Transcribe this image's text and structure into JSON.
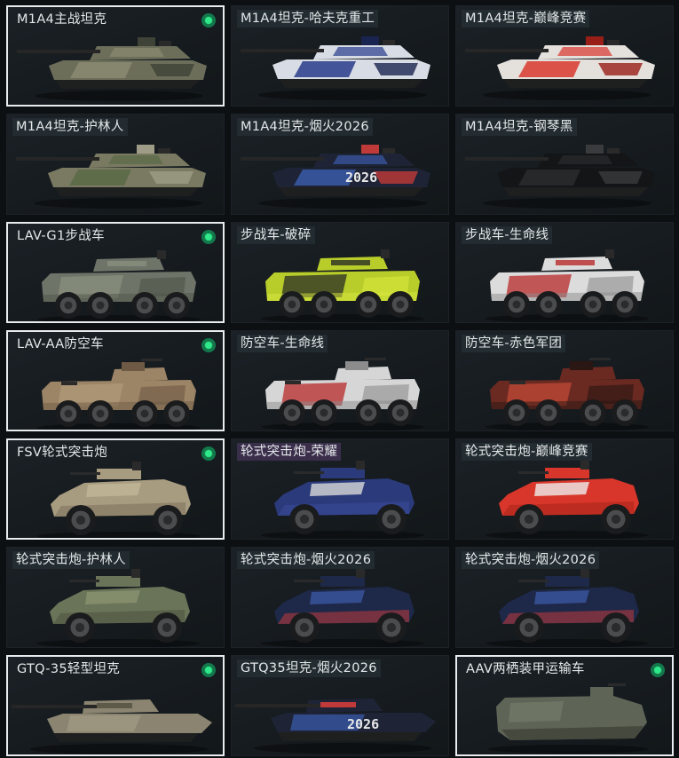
{
  "cards": [
    {
      "label": "M1A4主战坦克",
      "type": "tank",
      "owned": true,
      "selected": true,
      "base": "#6c6e5a",
      "accent": "#8b8a72",
      "accent2": "#3f4236"
    },
    {
      "label": "M1A4坦克-哈夫克重工",
      "type": "tank",
      "owned": false,
      "selected": false,
      "base": "#d8dce4",
      "accent": "#2a3c8c",
      "accent2": "#1a2450"
    },
    {
      "label": "M1A4坦克-巅峰竞赛",
      "type": "tank",
      "owned": false,
      "selected": false,
      "base": "#e4e0dc",
      "accent": "#d8382e",
      "accent2": "#9a1e18"
    },
    {
      "label": "M1A4坦克-护林人",
      "type": "tank",
      "owned": false,
      "selected": false,
      "base": "#7a7a62",
      "accent": "#5a6a46",
      "accent2": "#9e9c86"
    },
    {
      "label": "M1A4坦克-烟火2026",
      "type": "tank",
      "owned": false,
      "selected": false,
      "base": "#1e2436",
      "accent": "#3a5aa8",
      "accent2": "#c03a3a",
      "text": "2026"
    },
    {
      "label": "M1A4坦克-钢琴黑",
      "type": "tank",
      "owned": false,
      "selected": false,
      "base": "#141516",
      "accent": "#2a2b2d",
      "accent2": "#3a3b3d"
    },
    {
      "label": "LAV-G1步战车",
      "type": "ifv",
      "owned": true,
      "selected": true,
      "base": "#6e7468",
      "accent": "#8a907e",
      "accent2": "#4e5448"
    },
    {
      "label": "步战车-破碎",
      "type": "ifv",
      "owned": false,
      "selected": false,
      "base": "#b8cc2a",
      "accent": "#2a2e26",
      "accent2": "#d8e840"
    },
    {
      "label": "步战车-生命线",
      "type": "ifv",
      "owned": false,
      "selected": false,
      "base": "#dcdcdc",
      "accent": "#b82a2a",
      "accent2": "#8c8c8c"
    },
    {
      "label": "LAV-AA防空车",
      "type": "aa",
      "owned": true,
      "selected": true,
      "base": "#9c8466",
      "accent": "#b09a7a",
      "accent2": "#6e5a44"
    },
    {
      "label": "防空车-生命线",
      "type": "aa",
      "owned": false,
      "selected": false,
      "base": "#d6d6d6",
      "accent": "#b82a2a",
      "accent2": "#8c8c8c"
    },
    {
      "label": "防空车-赤色军团",
      "type": "aa",
      "owned": false,
      "selected": false,
      "base": "#6a2a22",
      "accent": "#c24a36",
      "accent2": "#2a1612"
    },
    {
      "label": "FSV轮式突击炮",
      "type": "fsv",
      "owned": true,
      "selected": true,
      "base": "#a89c80",
      "accent": "#c2b698",
      "accent2": "#7a705a"
    },
    {
      "label": "轮式突击炮-荣耀",
      "type": "fsv",
      "owned": false,
      "selected": false,
      "base": "#2a3a7a",
      "accent": "#d8d8d8",
      "accent2": "#3a4a9a",
      "highlight": true
    },
    {
      "label": "轮式突击炮-巅峰竞赛",
      "type": "fsv",
      "owned": false,
      "selected": false,
      "base": "#d8362a",
      "accent": "#eeeeee",
      "accent2": "#a82418"
    },
    {
      "label": "轮式突击炮-护林人",
      "type": "fsv",
      "owned": false,
      "selected": false,
      "base": "#6a7458",
      "accent": "#8a9270",
      "accent2": "#4a5240"
    },
    {
      "label": "轮式突击炮-烟火2026",
      "type": "fsv",
      "owned": false,
      "selected": false,
      "base": "#1e2848",
      "accent": "#3a56a0",
      "accent2": "#c03a3a"
    },
    {
      "label": "轮式突击炮-烟火2026",
      "type": "fsv",
      "owned": false,
      "selected": false,
      "base": "#1e2848",
      "accent": "#3a56a0",
      "accent2": "#c03a3a"
    },
    {
      "label": "GTQ-35轻型坦克",
      "type": "light",
      "owned": true,
      "selected": true,
      "base": "#8a8470",
      "accent": "#a09a84",
      "accent2": "#5e5a4a"
    },
    {
      "label": "GTQ35坦克-烟火2026",
      "type": "light",
      "owned": false,
      "selected": false,
      "base": "#1e2436",
      "accent": "#3a5aa8",
      "accent2": "#c03a3a",
      "text": "2026"
    },
    {
      "label": "AAV两栖装甲运输车",
      "type": "aav",
      "owned": true,
      "selected": true,
      "base": "#5e6456",
      "accent": "#747a6a",
      "accent2": "#3e4238"
    }
  ]
}
